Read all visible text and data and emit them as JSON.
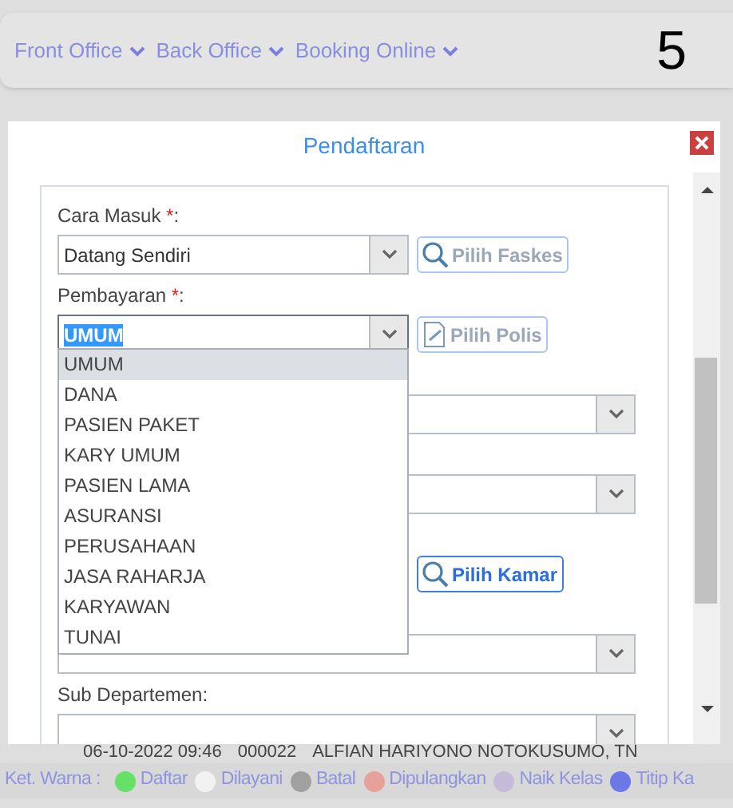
{
  "nav": {
    "items": [
      {
        "label": "Front Office"
      },
      {
        "label": "Back Office"
      },
      {
        "label": "Booking Online"
      }
    ],
    "page_number": "5"
  },
  "dialog": {
    "title": "Pendaftaran",
    "fields": [
      {
        "kind": "select",
        "label": "Cara Masuk",
        "required_mark": "*",
        "label_suffix": ":",
        "value": "Datang Sendiri",
        "button": {
          "label": "Pilih Faskes",
          "disabled": true
        }
      },
      {
        "kind": "select",
        "label": "Pembayaran",
        "required_mark": "*",
        "label_suffix": ":",
        "value": "UMUM",
        "focused": true,
        "button": {
          "label": "Pilih Polis",
          "disabled": true
        }
      },
      {
        "kind": "wide_select"
      },
      {
        "kind": "wide_select"
      },
      {
        "kind": "button_only",
        "button": {
          "label": "Pilih Kamar",
          "disabled": false
        }
      },
      {
        "kind": "wide_select"
      },
      {
        "kind": "wide_select",
        "label": "Sub Departemen",
        "label_suffix": ":"
      }
    ],
    "dropdown": [
      {
        "label": "UMUM",
        "selected": true
      },
      {
        "label": "DANA",
        "selected": false
      },
      {
        "label": "PASIEN PAKET",
        "selected": false
      },
      {
        "label": "KARY UMUM",
        "selected": false
      },
      {
        "label": "PASIEN LAMA",
        "selected": false
      },
      {
        "label": "ASURANSI",
        "selected": false
      },
      {
        "label": "PERUSAHAAN",
        "selected": false
      },
      {
        "label": "JASA RAHARJA",
        "selected": false
      },
      {
        "label": "KARYAWAN",
        "selected": false
      },
      {
        "label": "TUNAI",
        "selected": false
      }
    ]
  },
  "background_row": [
    "06-10-2022 09:46",
    "000022",
    "ALFIAN HARIYONO NOTOKUSUMO, TN"
  ],
  "legend": {
    "label": "Ket. Warna :",
    "items": [
      {
        "label": "Daftar",
        "color": "#66e066"
      },
      {
        "label": "Dilayani",
        "color": "#f2f2f2"
      },
      {
        "label": "Batal",
        "color": "#a0a0a0"
      },
      {
        "label": "Dipulangkan",
        "color": "#e8a09a"
      },
      {
        "label": "Naik Kelas",
        "color": "#c4bcd8"
      },
      {
        "label": "Titip Ka",
        "color": "#6b78e6"
      }
    ]
  }
}
